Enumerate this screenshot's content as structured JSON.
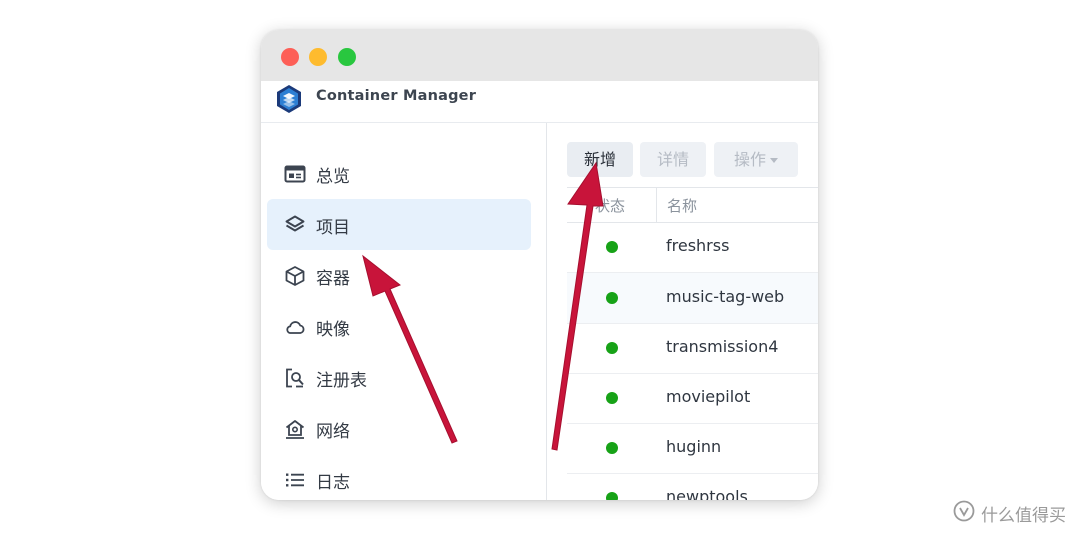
{
  "app": {
    "title": "Container Manager"
  },
  "sidebar": {
    "items": [
      {
        "label": "总览",
        "icon": "overview-icon"
      },
      {
        "label": "项目",
        "icon": "layers-icon",
        "active": true
      },
      {
        "label": "容器",
        "icon": "cube-icon"
      },
      {
        "label": "映像",
        "icon": "cloud-icon"
      },
      {
        "label": "注册表",
        "icon": "registry-search-icon"
      },
      {
        "label": "网络",
        "icon": "network-house-icon"
      },
      {
        "label": "日志",
        "icon": "list-icon"
      }
    ]
  },
  "toolbar": {
    "add_label": "新增",
    "detail_label": "详情",
    "action_label": "操作"
  },
  "table": {
    "columns": [
      "状态",
      "名称"
    ],
    "rows": [
      {
        "status": "running",
        "name": "freshrss"
      },
      {
        "status": "running",
        "name": "music-tag-web"
      },
      {
        "status": "running",
        "name": "transmission4"
      },
      {
        "status": "running",
        "name": "moviepilot"
      },
      {
        "status": "running",
        "name": "huginn"
      },
      {
        "status": "running",
        "name": "newptools"
      }
    ]
  },
  "colors": {
    "running": "#17a217",
    "annotation_arrow": "#c8143a",
    "active_nav_bg": "#e6f1fc"
  },
  "watermark": {
    "text": "什么值得买"
  }
}
